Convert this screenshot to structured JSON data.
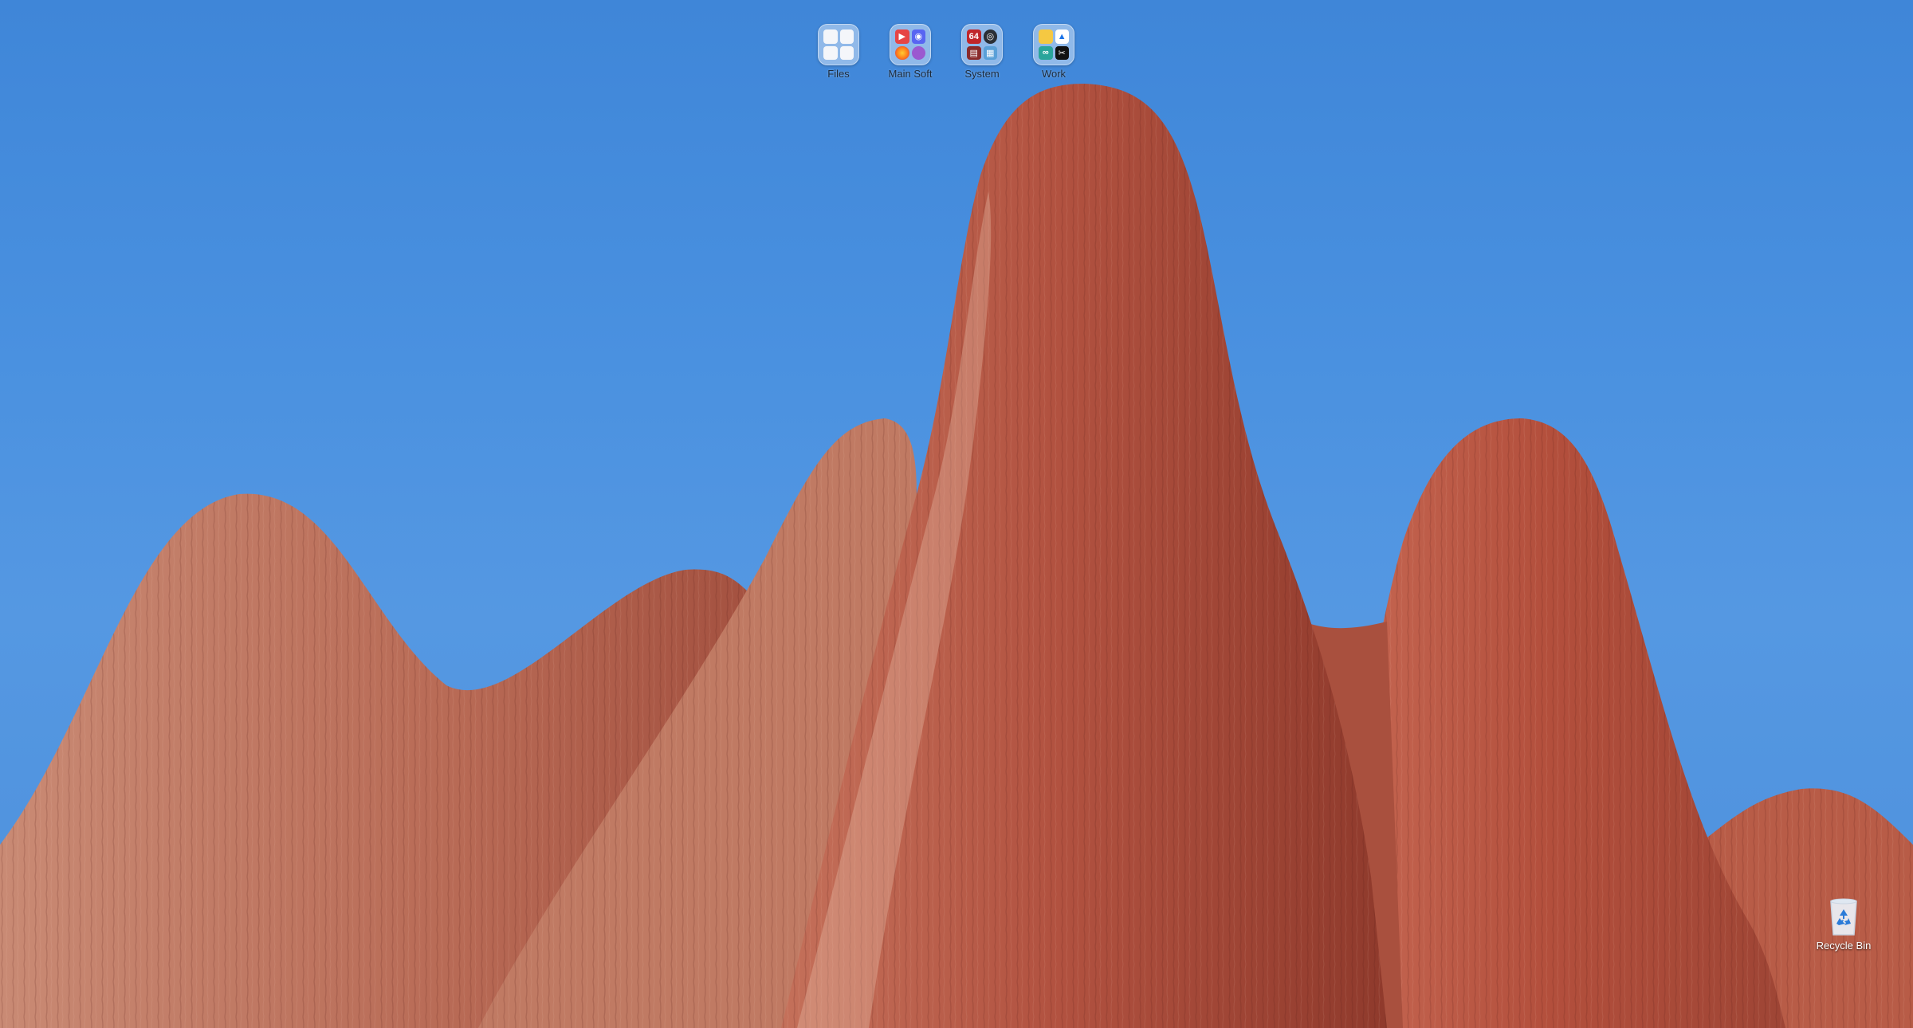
{
  "desktop": {
    "wallpaper": "sandstone-hoodoos-blue-sky",
    "sky_color": "#4a91e0",
    "rock_color": "#b5553f"
  },
  "folders": [
    {
      "label": "Files",
      "icons": [
        "window-tile-icon",
        "window-tile-icon",
        "window-tile-icon",
        "window-tile-icon"
      ]
    },
    {
      "label": "Main Soft",
      "icons": [
        "media-player-icon",
        "discord-icon",
        "firefox-icon",
        "purple-app-icon"
      ]
    },
    {
      "label": "System",
      "icons": [
        "cpu-z-icon",
        "hardware-monitor-icon",
        "storage-tool-icon",
        "system-info-icon"
      ],
      "icon_text": "64"
    },
    {
      "label": "Work",
      "icons": [
        "file-explorer-icon",
        "google-drive-icon",
        "link-icon",
        "capcut-icon"
      ]
    }
  ],
  "recycle_bin": {
    "label": "Recycle Bin",
    "icon": "recycle-bin-icon"
  }
}
